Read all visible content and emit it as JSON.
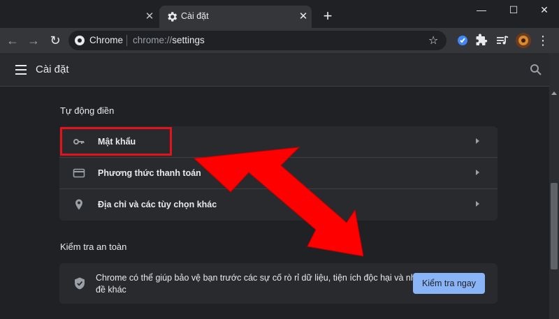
{
  "tabs": {
    "active_title": "Cài đặt",
    "close_glyph": "✕",
    "new_tab_glyph": "+"
  },
  "window_controls": {
    "minimize": "—",
    "maximize": "☐",
    "close": "✕"
  },
  "toolbar": {
    "back_glyph": "←",
    "forward_glyph": "→",
    "reload_glyph": "↻",
    "site_chip": "Chrome",
    "url_scheme": "chrome://",
    "url_host": "settings",
    "star_glyph": "☆",
    "more_glyph": "⋮"
  },
  "header": {
    "title": "Cài đặt"
  },
  "autofill": {
    "section_title": "Tự động điền",
    "items": [
      {
        "label": "Mật khẩu",
        "icon": "key-icon"
      },
      {
        "label": "Phương thức thanh toán",
        "icon": "credit-card-icon"
      },
      {
        "label": "Địa chỉ và các tùy chọn khác",
        "icon": "location-pin-icon"
      }
    ]
  },
  "safety": {
    "section_title": "Kiểm tra an toàn",
    "description": "Chrome có thể giúp bảo vệ bạn trước các sự cố rò rỉ dữ liệu, tiện ích độc hại và những vấn đề khác",
    "button_label": "Kiểm tra ngay",
    "icon": "shield-check-icon"
  },
  "colors": {
    "accent": "#8ab4f8",
    "background": "#202124",
    "card": "#292a2d",
    "annotation_red": "#e4131b"
  }
}
